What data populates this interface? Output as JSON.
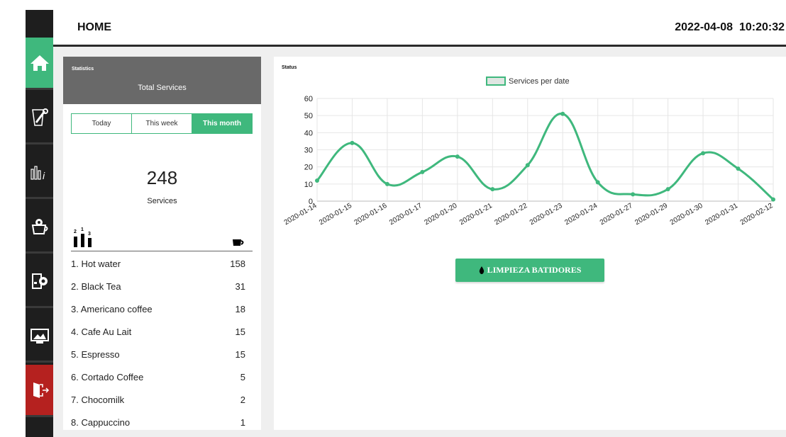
{
  "header": {
    "title": "HOME",
    "datetime": "2022-04-08  10:20:32"
  },
  "sidebar": {
    "items": [
      {
        "name": "home",
        "icon": "home-icon"
      },
      {
        "name": "maintenance",
        "icon": "wrench-icon"
      },
      {
        "name": "statistics",
        "icon": "stats-info-icon"
      },
      {
        "name": "drink-settings",
        "icon": "cup-gear-icon"
      },
      {
        "name": "machine-settings",
        "icon": "machine-gear-icon"
      },
      {
        "name": "display",
        "icon": "monitor-image-icon"
      },
      {
        "name": "exit",
        "icon": "exit-door-icon"
      }
    ],
    "accent": "#3fb87d",
    "exit_color": "#b5211f"
  },
  "stats": {
    "label": "Statistics",
    "title": "Total Services",
    "tabs": [
      "Today",
      "This week",
      "This month"
    ],
    "active_tab": "This month",
    "total": "248",
    "total_label": "Services",
    "rank_digits": [
      "2",
      "1",
      "3"
    ],
    "rows": [
      {
        "name": "1. Hot water",
        "count": "158"
      },
      {
        "name": "2. Black Tea",
        "count": "31"
      },
      {
        "name": "3. Americano coffee",
        "count": "18"
      },
      {
        "name": "4. Cafe Au Lait",
        "count": "15"
      },
      {
        "name": "5. Espresso",
        "count": "15"
      },
      {
        "name": "6. Cortado Coffee",
        "count": "5"
      },
      {
        "name": "7. Chocomilk",
        "count": "2"
      },
      {
        "name": "8. Cappuccino",
        "count": "1"
      }
    ]
  },
  "status": {
    "label": "Status",
    "button_label": "LIMPIEZA BATIDORES"
  },
  "chart_data": {
    "type": "line",
    "title": "",
    "legend": "top",
    "grid": true,
    "ylim": [
      0,
      60
    ],
    "yticks": [
      "0",
      "10",
      "20",
      "30",
      "40",
      "50",
      "60"
    ],
    "categories": [
      "2020-01-14",
      "2020-01-15",
      "2020-01-16",
      "2020-01-17",
      "2020-01-20",
      "2020-01-21",
      "2020-01-22",
      "2020-01-23",
      "2020-01-24",
      "2020-01-27",
      "2020-01-29",
      "2020-01-30",
      "2020-01-31",
      "2020-02-12"
    ],
    "series": [
      {
        "name": "Services per date",
        "color": "#3fb87d",
        "values": [
          12,
          34,
          10,
          17,
          26,
          7,
          21,
          51,
          11,
          4,
          7,
          28,
          19,
          1
        ]
      }
    ]
  }
}
